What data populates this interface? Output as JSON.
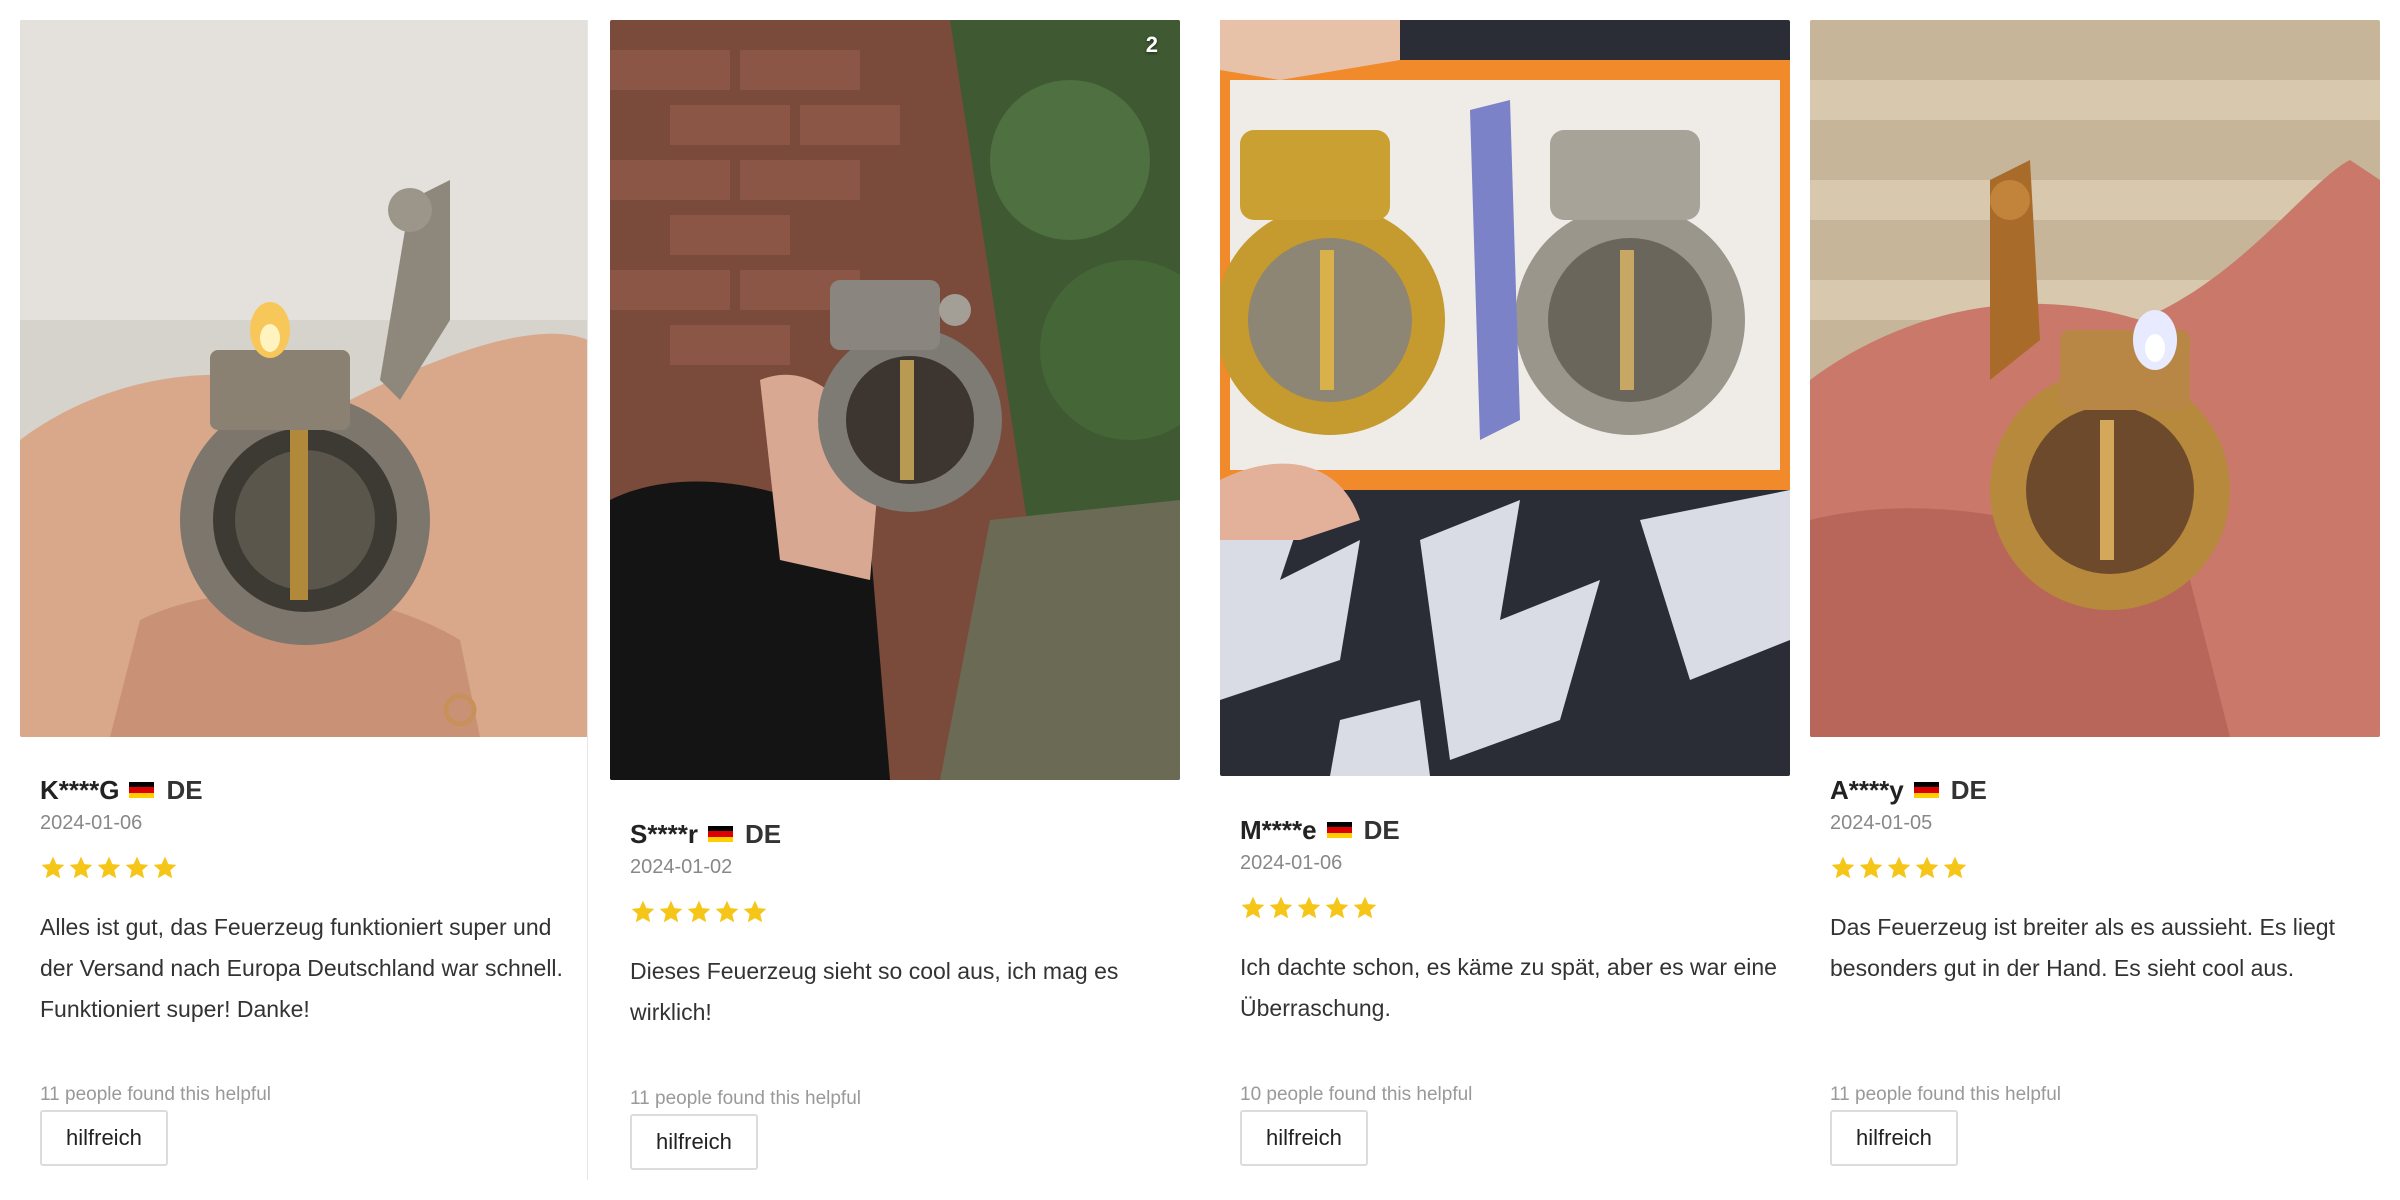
{
  "reviews": [
    {
      "name": "K****G",
      "country": "DE",
      "date": "2024-01-06",
      "rating": 5,
      "text": "Alles ist gut, das Feuerzeug funktioniert super und der Versand nach Europa Deutschland war schnell. Funktioniert super! Danke!",
      "helpful_text": "11 people found this helpful",
      "helpful_button": "hilfreich"
    },
    {
      "name": "S****r",
      "country": "DE",
      "date": "2024-01-02",
      "rating": 5,
      "text": "Dieses Feuerzeug sieht so cool aus, ich mag es wirklich!",
      "helpful_text": "11 people found this helpful",
      "helpful_button": "hilfreich",
      "photo_count": "2"
    },
    {
      "name": "M****e",
      "country": "DE",
      "date": "2024-01-06",
      "rating": 5,
      "text": "Ich dachte schon, es käme zu spät, aber es war eine Überraschung.",
      "helpful_text": "10 people found this helpful",
      "helpful_button": "hilfreich"
    },
    {
      "name": "A****y",
      "country": "DE",
      "date": "2024-01-05",
      "rating": 5,
      "text": "Das Feuerzeug ist breiter als es aussieht. Es liegt besonders gut in der Hand. Es sieht cool aus.",
      "helpful_text": "11 people found this helpful",
      "helpful_button": "hilfreich"
    }
  ],
  "colors": {
    "star": "#f5c518",
    "flag_black": "#000000",
    "flag_red": "#dd0000",
    "flag_gold": "#ffce00"
  },
  "icons": {
    "star": "star-icon",
    "flag": "germany-flag-icon"
  }
}
